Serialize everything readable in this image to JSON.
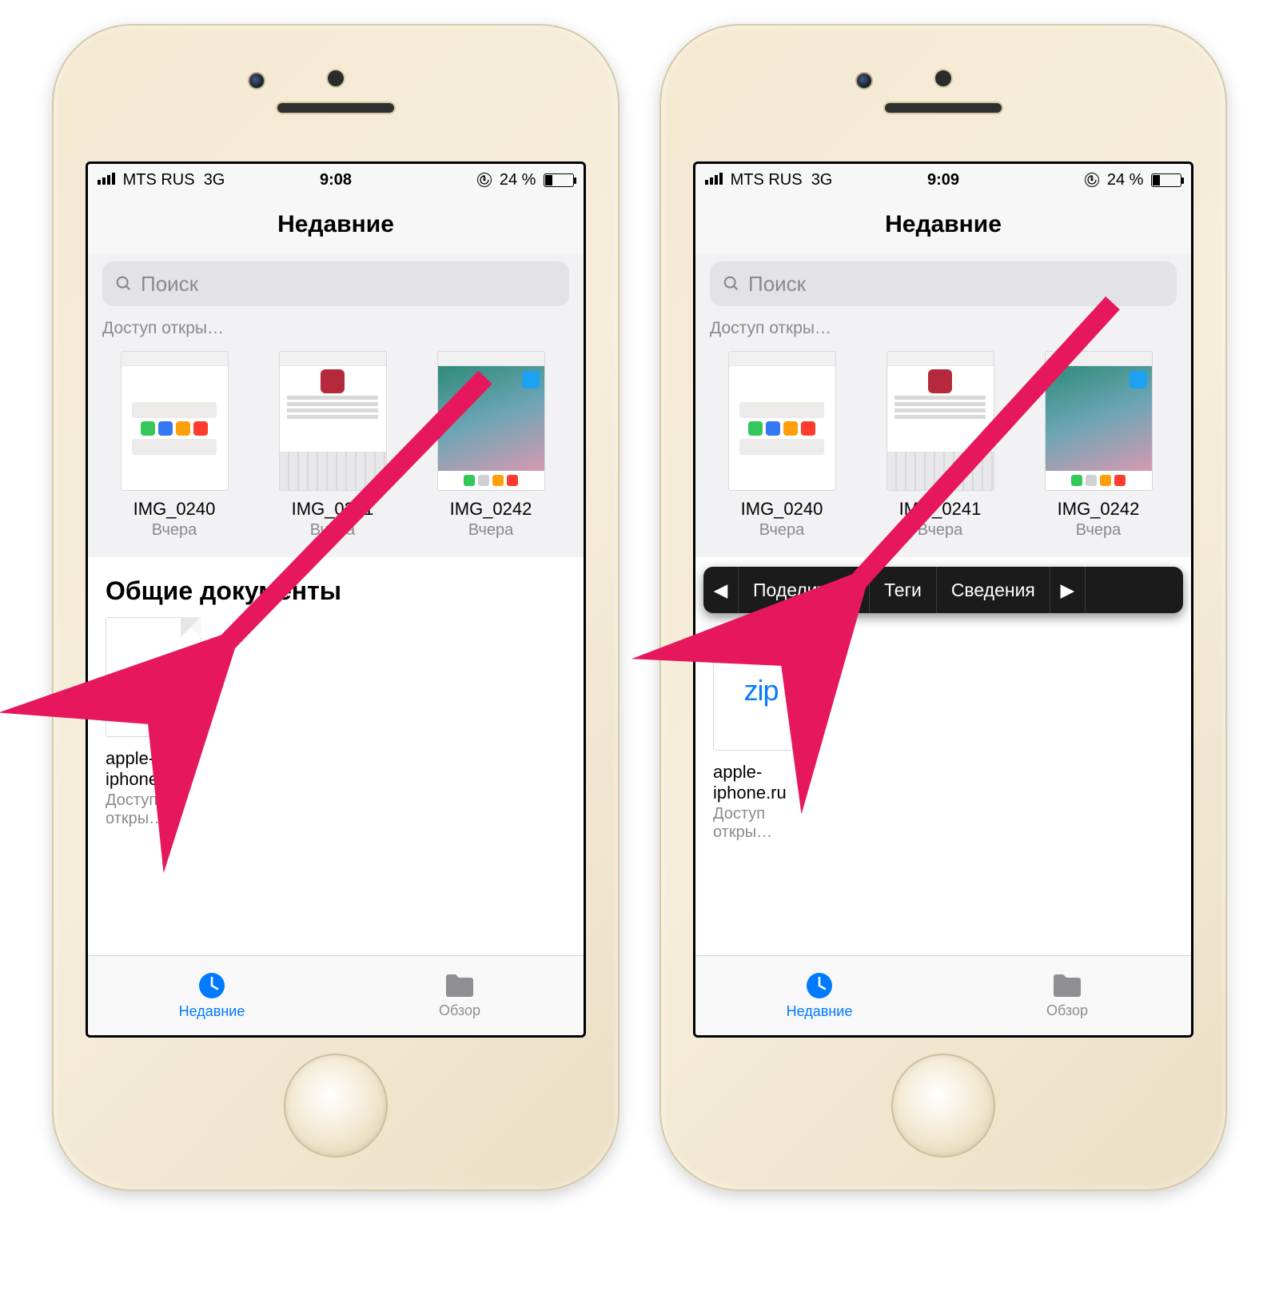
{
  "status_left": {
    "carrier": "MTS RUS",
    "net": "3G"
  },
  "status_time": [
    "9:08",
    "9:09"
  ],
  "status_right": {
    "battery": "24 %"
  },
  "nav_title": "Недавние",
  "search_placeholder": "Поиск",
  "shared_label": "Доступ откры…",
  "thumbs": [
    {
      "name": "IMG_0240",
      "date": "Вчера"
    },
    {
      "name": "IMG_0241",
      "date": "Вчера"
    },
    {
      "name": "IMG_0242",
      "date": "Вчера"
    }
  ],
  "section_heading": "Общие документы",
  "zip": {
    "ext": "zip",
    "name": "apple-\niphone.ru",
    "sub": "Доступ откры…"
  },
  "tabs": {
    "recent": "Недавние",
    "browse": "Обзор"
  },
  "context_menu": {
    "prev": "◀",
    "share": "Поделиться",
    "tags": "Теги",
    "info": "Сведения",
    "next": "▶"
  }
}
